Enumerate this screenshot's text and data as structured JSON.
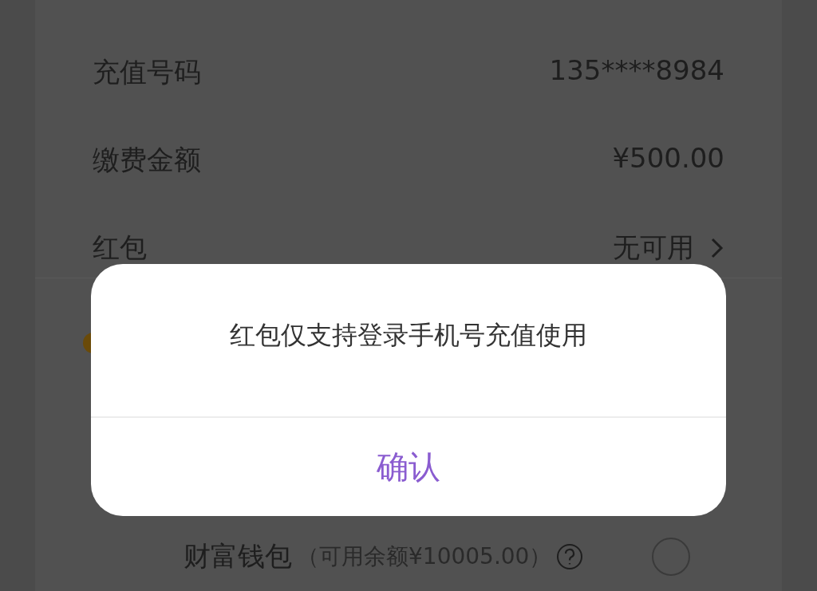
{
  "rows": [
    {
      "label": "充值号码",
      "value": "135****8984",
      "has_arrow": false
    },
    {
      "label": "缴费金额",
      "value": "¥500.00",
      "has_arrow": false
    },
    {
      "label": "红包",
      "value": "无可用",
      "has_arrow": true
    }
  ],
  "wallet": {
    "name": "财富钱包",
    "balance": "（可用余额¥10005.00）",
    "selected": false
  },
  "dialog": {
    "message": "红包仅支持登录手机号充值使用",
    "button": "确认"
  }
}
